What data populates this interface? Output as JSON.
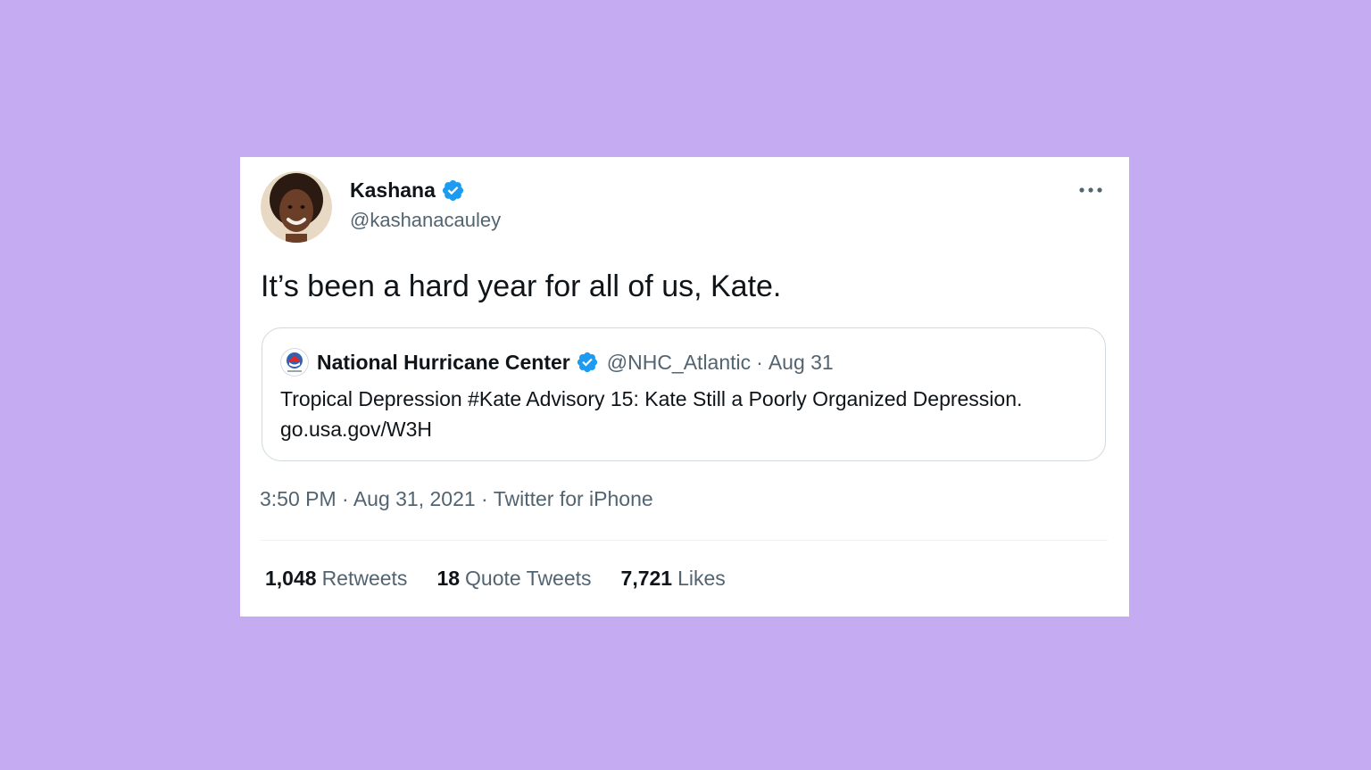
{
  "colors": {
    "background": "#c4abf2",
    "card": "#ffffff",
    "verified_blue": "#1d9bf0",
    "secondary_text": "#536471"
  },
  "tweet": {
    "author": {
      "display_name": "Kashana",
      "handle": "@kashanacauley",
      "verified_icon": "verified-badge-icon"
    },
    "more_icon": "more-options-icon",
    "text": "It’s been a hard year for all of us, Kate.",
    "quoted": {
      "display_name": "National Hurricane Center",
      "handle": "@NHC_Atlantic",
      "separator": "·",
      "date": "Aug 31",
      "text": "Tropical Depression #Kate Advisory 15: Kate Still a Poorly Organized Depression. go.usa.gov/W3H"
    },
    "meta": "3:50 PM · Aug 31, 2021 · Twitter for iPhone",
    "stats": [
      {
        "count": "1,048",
        "label": "Retweets"
      },
      {
        "count": "18",
        "label": "Quote Tweets"
      },
      {
        "count": "7,721",
        "label": "Likes"
      }
    ]
  }
}
